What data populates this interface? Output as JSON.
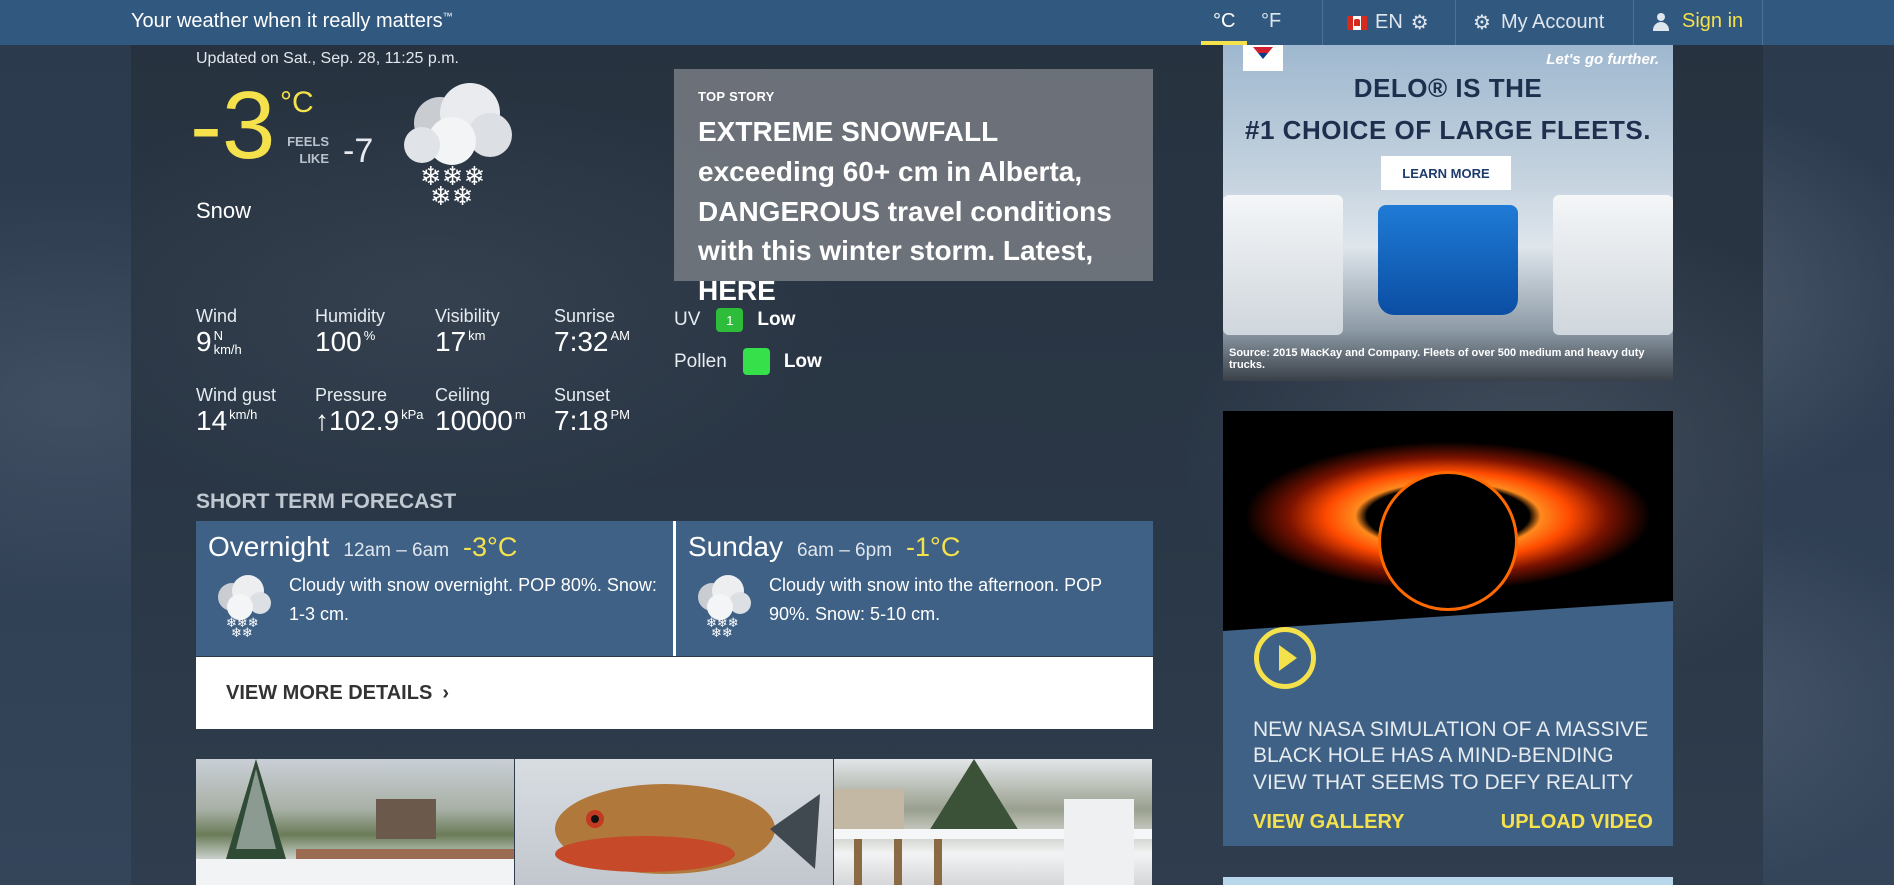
{
  "header": {
    "tagline": "Your weather when it really matters",
    "tagline_mark": "™",
    "unit_c": "°C",
    "unit_f": "°F",
    "lang": "EN",
    "account": "My Account",
    "signin": "Sign in"
  },
  "current": {
    "updated": "Updated on Sat., Sep. 28, 11:25 p.m.",
    "temp": "-3",
    "temp_unit": "°C",
    "feels_label": "FEELS LIKE",
    "feels_value": "-7",
    "condition": "Snow"
  },
  "metrics": {
    "wind": {
      "label": "Wind",
      "value": "9",
      "dir": "N",
      "unit": "km/h"
    },
    "humidity": {
      "label": "Humidity",
      "value": "100",
      "unit": "%"
    },
    "visibility": {
      "label": "Visibility",
      "value": "17",
      "unit": "km"
    },
    "sunrise": {
      "label": "Sunrise",
      "value": "7:32",
      "unit": "AM"
    },
    "wind_gust": {
      "label": "Wind gust",
      "value": "14",
      "unit": "km/h"
    },
    "pressure": {
      "label": "Pressure",
      "value": "↑102.9",
      "unit": "kPa"
    },
    "ceiling": {
      "label": "Ceiling",
      "value": "10000",
      "unit": "m"
    },
    "sunset": {
      "label": "Sunset",
      "value": "7:18",
      "unit": "PM"
    }
  },
  "indices": {
    "uv_label": "UV",
    "uv_value": "1",
    "uv_level": "Low",
    "pollen_label": "Pollen",
    "pollen_level": "Low",
    "uv_color": "#2ebd3b",
    "pollen_color": "#35e04a"
  },
  "story": {
    "kicker": "TOP STORY",
    "headline": "EXTREME SNOWFALL exceeding 60+ cm in Alberta, DANGEROUS travel conditions with this winter storm. Latest, HERE"
  },
  "short_term": {
    "title": "SHORT TERM FORECAST",
    "periods": [
      {
        "name": "Overnight",
        "hours": "12am – 6am",
        "temp": "-3°C",
        "text": "Cloudy with snow overnight. POP 80%. Snow: 1-3 cm.",
        "icon": "snow-cloud-icon"
      },
      {
        "name": "Sunday",
        "hours": "6am – 6pm",
        "temp": "-1°C",
        "text": "Cloudy with snow into the afternoon. POP 90%. Snow: 5-10 cm.",
        "icon": "snow-cloud-icon"
      }
    ],
    "details_label": "VIEW MORE DETAILS",
    "details_chevron": "›"
  },
  "ads": {
    "delo_tagline": "Let's go further.",
    "delo_line1": "DELO® IS THE",
    "delo_line2": "#1 CHOICE OF LARGE FLEETS.",
    "delo_button": "LEARN MORE",
    "delo_source": "Source: 2015 MacKay and Company. Fleets of over 500 medium and heavy duty trucks.",
    "video_caption": "NEW NASA SIMULATION OF A MASSIVE BLACK HOLE HAS A MIND-BENDING VIEW THAT SEEMS TO DEFY REALITY",
    "view_gallery": "VIEW GALLERY",
    "upload_video": "UPLOAD VIDEO"
  },
  "colors": {
    "accent_yellow": "#f5e14b",
    "header_blue": "#31587f",
    "card_blue": "#3f6185"
  }
}
